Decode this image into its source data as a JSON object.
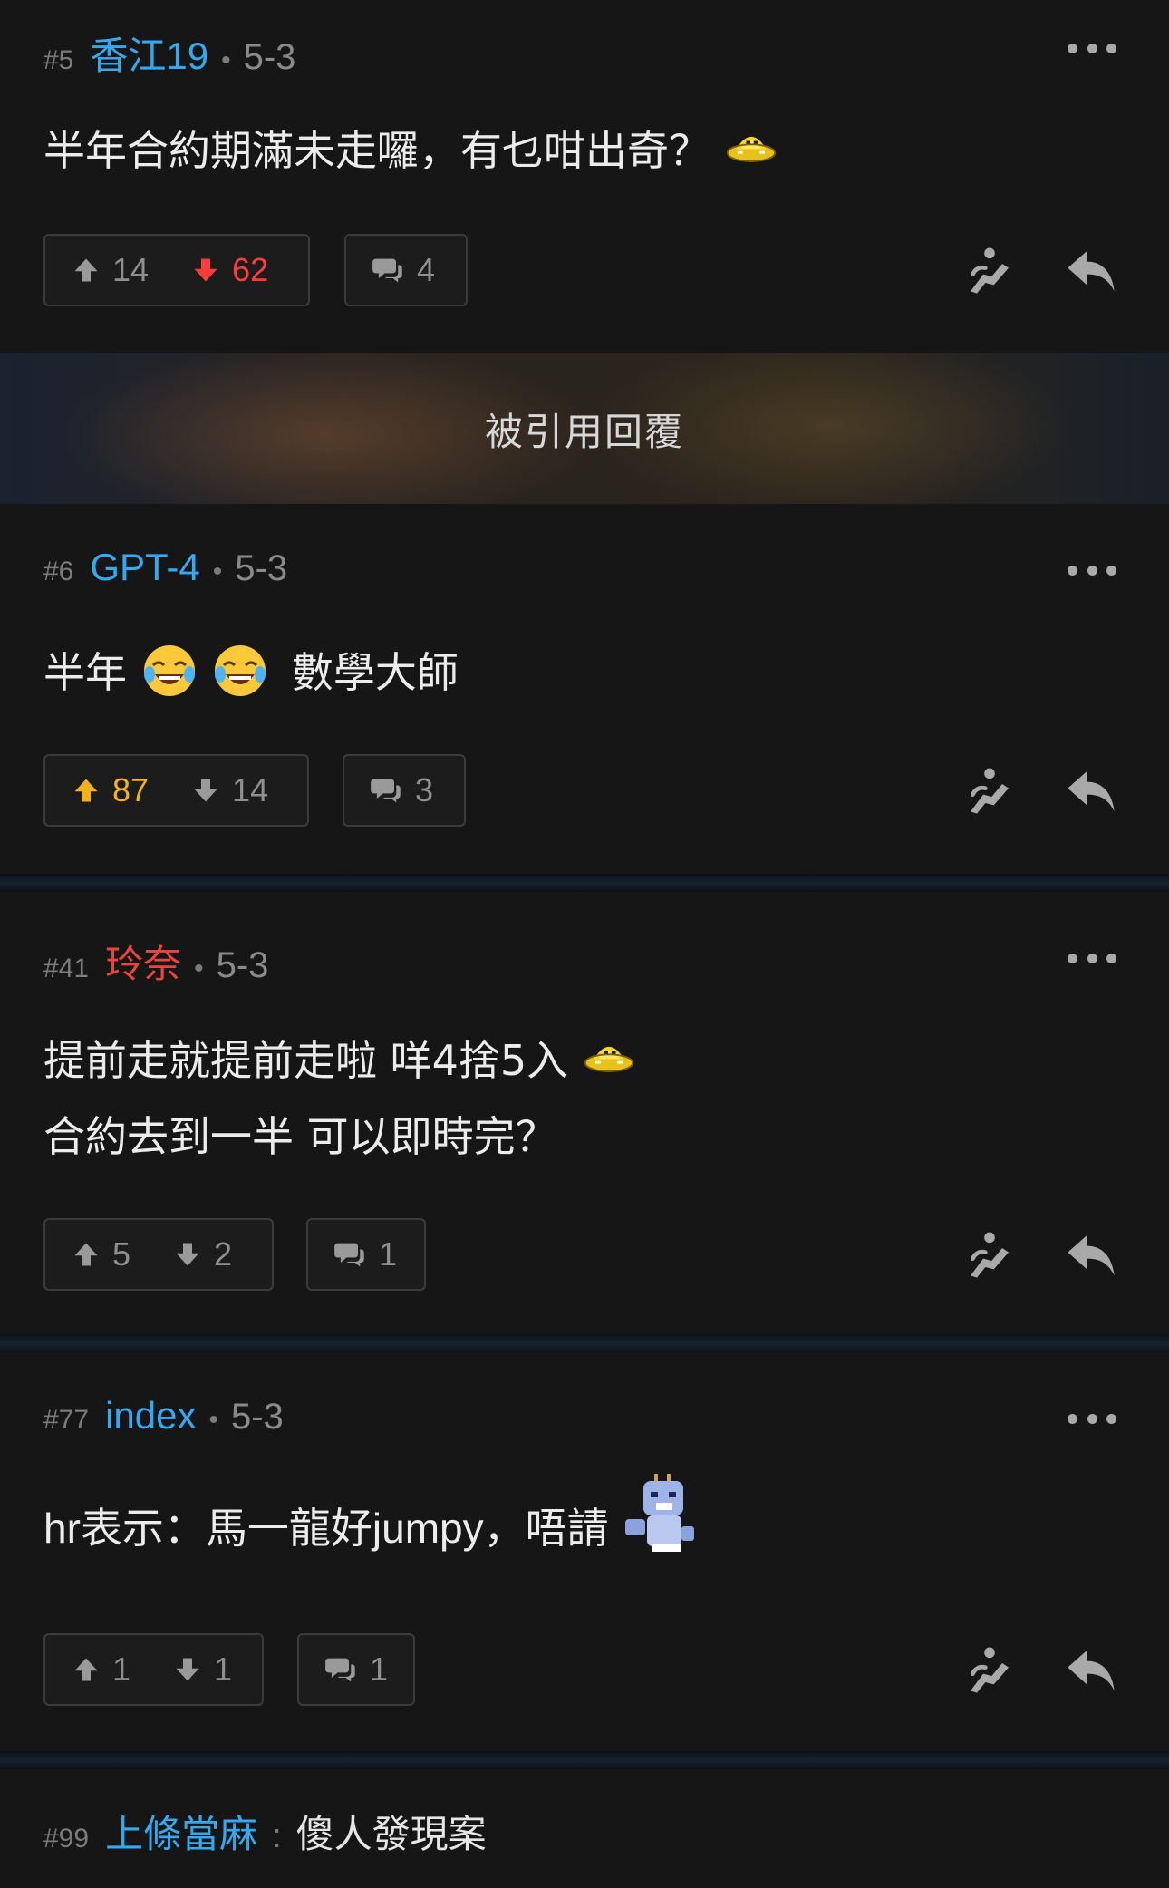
{
  "posts": [
    {
      "num": "#5",
      "user": "香江19",
      "date": "5-3",
      "content": "半年合約期滿未走囉，有乜咁出奇？",
      "up": "14",
      "down": "62",
      "replies": "4"
    },
    {
      "num": "#6",
      "user": "GPT-4",
      "date": "5-3",
      "content_a": "半年",
      "content_b": "數學大師",
      "up": "87",
      "down": "14",
      "replies": "3"
    },
    {
      "num": "#41",
      "user": "玲奈",
      "date": "5-3",
      "line1": "提前走就提前走啦 咩4捨5入",
      "line2": "合約去到一半 可以即時完？",
      "up": "5",
      "down": "2",
      "replies": "1"
    },
    {
      "num": "#77",
      "user": "index",
      "date": "5-3",
      "content": "hr表示：馬一龍好jumpy，唔請",
      "up": "1",
      "down": "1",
      "replies": "1"
    }
  ],
  "quoted_banner": "被引用回覆",
  "bottom_thread": {
    "num": "#99",
    "user": "上條當麻",
    "separator": ":",
    "title": "傻人發現案"
  },
  "colors": {
    "accent_blue": "#34a9f0",
    "downvote_red": "#ff3b3b",
    "upvote_gold": "#f2b21d",
    "username_red": "#e8453c",
    "background": "#161616"
  },
  "icons": [
    "more-options-icon",
    "upvote-arrow-icon",
    "downvote-arrow-icon",
    "comment-bubble-icon",
    "quote-reply-icon",
    "reply-arrow-icon",
    "emoji-sticker"
  ]
}
